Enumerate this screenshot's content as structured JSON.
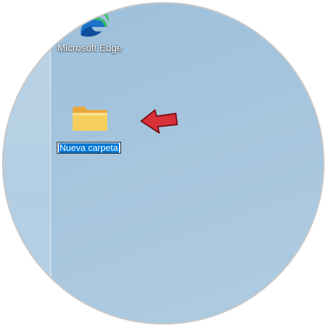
{
  "desktop": {
    "icons": [
      {
        "label": "Microsoft Edge",
        "icon": "edge-icon"
      },
      {
        "label": "Nueva carpeta",
        "icon": "folder-icon",
        "renaming": true
      }
    ],
    "annotation": {
      "icon": "red-arrow-icon",
      "color": "#d9303a"
    },
    "colors": {
      "selection": "#0078d7",
      "folder": "#f5c542",
      "background": "#a4c4dd"
    }
  }
}
